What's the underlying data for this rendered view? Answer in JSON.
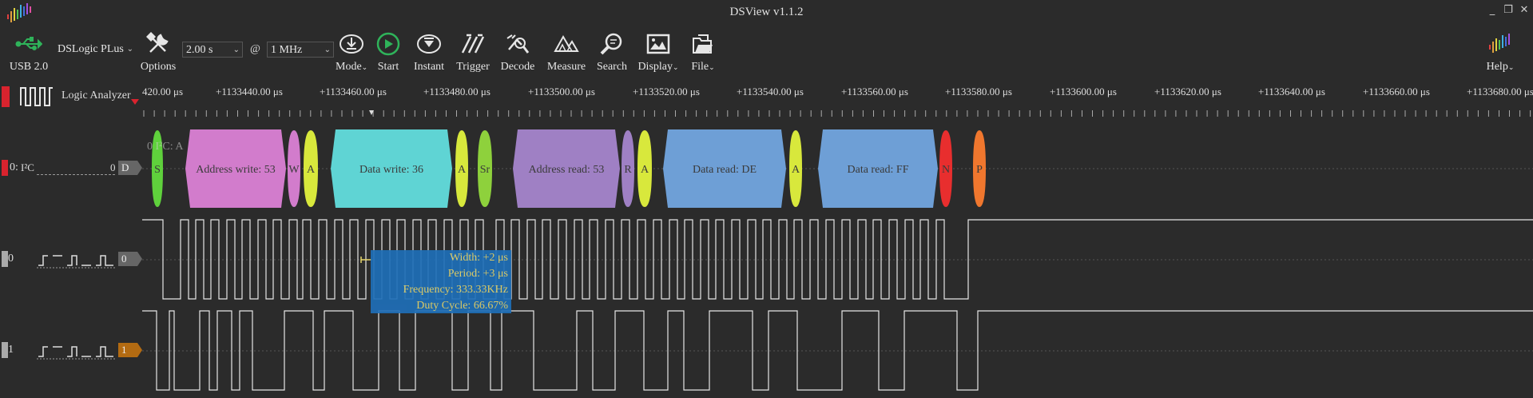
{
  "window": {
    "title": "DSView v1.1.2"
  },
  "toolbar": {
    "usb_label": "USB 2.0",
    "device": "DSLogic PLus",
    "options_label": "Options",
    "duration": "2.00 s",
    "at_symbol": "@",
    "samplerate": "1 MHz",
    "buttons": [
      {
        "label": "Mode",
        "icon": "mode-icon"
      },
      {
        "label": "Start",
        "icon": "start-icon"
      },
      {
        "label": "Instant",
        "icon": "instant-icon"
      },
      {
        "label": "Trigger",
        "icon": "trigger-icon"
      },
      {
        "label": "Decode",
        "icon": "decode-icon"
      },
      {
        "label": "Measure",
        "icon": "measure-icon"
      },
      {
        "label": "Search",
        "icon": "search-icon"
      },
      {
        "label": "Display",
        "icon": "display-icon"
      },
      {
        "label": "File",
        "icon": "file-icon"
      }
    ],
    "help_label": "Help"
  },
  "ruler": {
    "mode_label": "Logic Analyzer",
    "ticks": [
      "420.00 μs",
      "+1133440.00 μs",
      "+1133460.00 μs",
      "+1133480.00 μs",
      "+1133500.00 μs",
      "+1133520.00 μs",
      "+1133540.00 μs",
      "+1133560.00 μs",
      "+1133580.00 μs",
      "+1133600.00 μs",
      "+1133620.00 μs",
      "+1133640.00 μs",
      "+1133660.00 μs",
      "+1133680.00 μs"
    ]
  },
  "channels": {
    "decoder": {
      "index": "0:",
      "name": "I²C",
      "value": "0",
      "tag": "D",
      "ghost_text": "0 I²C: A"
    },
    "ch0": {
      "index": "0",
      "value": "",
      "tag": "0"
    },
    "ch1": {
      "index": "1",
      "value": "",
      "tag": "1"
    }
  },
  "annotations": [
    {
      "text": "S",
      "color": "#5fd13c"
    },
    {
      "text": "Address write: 53",
      "color": "#d27ccc"
    },
    {
      "text": "W",
      "color": "#d27ccc"
    },
    {
      "text": "A",
      "color": "#d8e83c"
    },
    {
      "text": "Data write: 36",
      "color": "#5fd4d4"
    },
    {
      "text": "A",
      "color": "#d8e83c"
    },
    {
      "text": "Sr",
      "color": "#8ed13c"
    },
    {
      "text": "Address read: 53",
      "color": "#9f80c4"
    },
    {
      "text": "R",
      "color": "#9f80c4"
    },
    {
      "text": "A",
      "color": "#d8e83c"
    },
    {
      "text": "Data read: DE",
      "color": "#6e9fd6"
    },
    {
      "text": "A",
      "color": "#d8e83c"
    },
    {
      "text": "Data read: FF",
      "color": "#6e9fd6"
    },
    {
      "text": "N",
      "color": "#e82e2e"
    },
    {
      "text": "P",
      "color": "#f0772e"
    }
  ],
  "measure": {
    "width": "Width: +2 μs",
    "period": "Period: +3 μs",
    "frequency": "Frequency: 333.33KHz",
    "duty": "Duty Cycle: 66.67%"
  },
  "colors": {
    "accent_red": "#d9232e",
    "start_green": "#2fb35a",
    "tooltip_bg": "#1f6fb8",
    "tooltip_text": "#e8d66a",
    "ch1_tag": "#b36b12"
  }
}
